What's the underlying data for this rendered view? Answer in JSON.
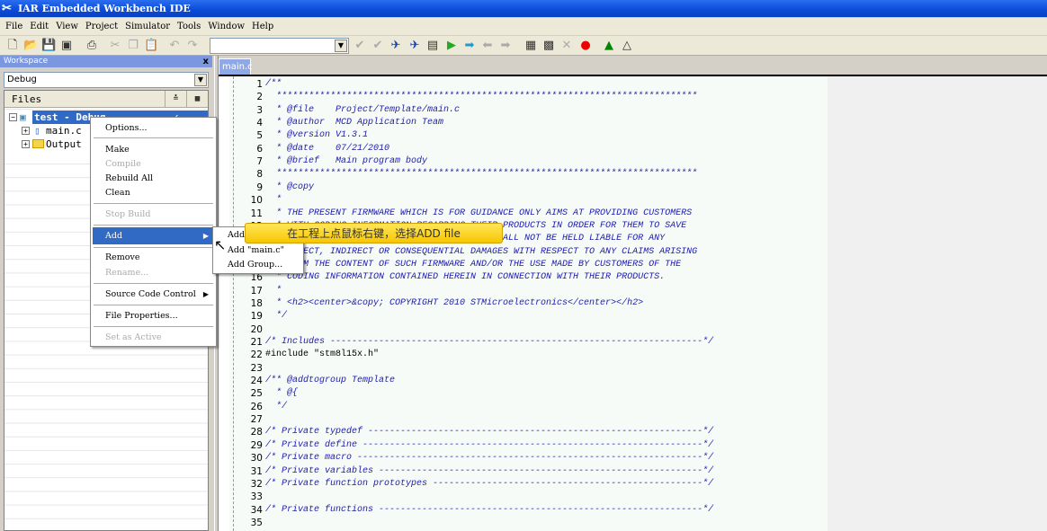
{
  "window": {
    "title": "IAR Embedded Workbench IDE"
  },
  "menubar": [
    "File",
    "Edit",
    "View",
    "Project",
    "Simulator",
    "Tools",
    "Window",
    "Help"
  ],
  "toolbar": {
    "config_value": "",
    "icons": [
      "new-file-icon",
      "open-icon",
      "save-icon",
      "save-all-icon",
      "print-icon",
      "cut-icon",
      "copy-icon",
      "paste-icon",
      "undo-icon",
      "redo-icon",
      "toggle-bookmark-icon",
      "goto-bookmark-icon",
      "find-icon",
      "replace-icon",
      "goto-icon",
      "next-icon",
      "next-bookmark-icon",
      "prev-icon",
      "forward-icon",
      "compile-icon",
      "make-icon",
      "stop-build-icon",
      "breakpoint-icon",
      "debug-icon",
      "debug-without-download-icon"
    ]
  },
  "workspace": {
    "title": "Workspace",
    "close": "x",
    "config": "Debug",
    "files_header": "Files",
    "tree": [
      {
        "label": "test - Debug",
        "check": "✓"
      },
      {
        "label": "main.c"
      },
      {
        "label": "Output"
      }
    ]
  },
  "editor": {
    "tab": "main.c",
    "lines": [
      "/**",
      "  ******************************************************************************",
      "  * @file    Project/Template/main.c",
      "  * @author  MCD Application Team",
      "  * @version V1.3.1",
      "  * @date    07/21/2010",
      "  * @brief   Main program body",
      "  ******************************************************************************",
      "  * @copy",
      "  *",
      "  * THE PRESENT FIRMWARE WHICH IS FOR GUIDANCE ONLY AIMS AT PROVIDING CUSTOMERS",
      "  * WITH CODING INFORMATION REGARDING THEIR PRODUCTS IN ORDER FOR THEM TO SAVE",
      "  * TIME. AS A RESULT, STMICROELECTRONICS SHALL NOT BE HELD LIABLE FOR ANY",
      "  * DIRECT, INDIRECT OR CONSEQUENTIAL DAMAGES WITH RESPECT TO ANY CLAIMS ARISING",
      "  * FROM THE CONTENT OF SUCH FIRMWARE AND/OR THE USE MADE BY CUSTOMERS OF THE",
      "  * CODING INFORMATION CONTAINED HEREIN IN CONNECTION WITH THEIR PRODUCTS.",
      "  *",
      "  * <h2><center>&copy; COPYRIGHT 2010 STMicroelectronics</center></h2>",
      "  */",
      "",
      "/* Includes ---------------------------------------------------------------------*/",
      "#include \"stm8l15x.h\"",
      "",
      "/** @addtogroup Template",
      "  * @{",
      "  */",
      "",
      "/* Private typedef --------------------------------------------------------------*/",
      "/* Private define ---------------------------------------------------------------*/",
      "/* Private macro ----------------------------------------------------------------*/",
      "/* Private variables ------------------------------------------------------------*/",
      "/* Private function prototypes --------------------------------------------------*/",
      "",
      "/* Private functions ------------------------------------------------------------*/",
      ""
    ]
  },
  "context_menu": {
    "items": [
      {
        "label": "Options...",
        "state": "normal"
      },
      {
        "label": "Make",
        "state": "normal"
      },
      {
        "label": "Compile",
        "state": "disabled"
      },
      {
        "label": "Rebuild All",
        "state": "normal"
      },
      {
        "label": "Clean",
        "state": "normal"
      },
      {
        "label": "Stop Build",
        "state": "disabled"
      },
      {
        "label": "Add",
        "state": "highlighted"
      },
      {
        "label": "Remove",
        "state": "normal"
      },
      {
        "label": "Rename...",
        "state": "disabled"
      },
      {
        "label": "Source Code Control",
        "state": "normal"
      },
      {
        "label": "File Properties...",
        "state": "normal"
      },
      {
        "label": "Set as Active",
        "state": "disabled"
      }
    ]
  },
  "submenu": {
    "items": [
      "Add Files...",
      "Add \"main.c\"",
      "Add Group..."
    ]
  },
  "tooltip": "在工程上点鼠标右键，选择ADD file",
  "colors": {
    "title_bar": "#0a4ad8",
    "selection": "#316ac5",
    "comment": "#1c1ca8",
    "tooltip": "#ffd92a"
  }
}
